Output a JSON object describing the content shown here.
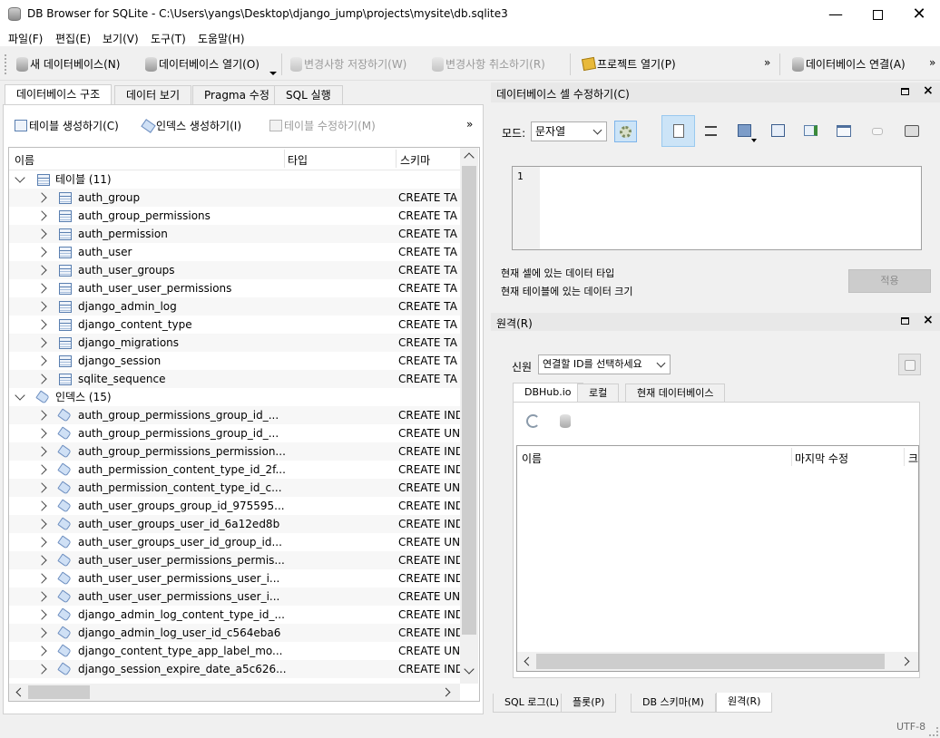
{
  "window": {
    "title": "DB Browser for SQLite - C:\\Users\\yangs\\Desktop\\django_jump\\projects\\mysite\\db.sqlite3"
  },
  "menu": [
    "파일(F)",
    "편집(E)",
    "보기(V)",
    "도구(T)",
    "도움말(H)"
  ],
  "toolbar": {
    "new_db": "새 데이터베이스(N)",
    "open_db": "데이터베이스 열기(O)",
    "write_changes": "변경사항 저장하기(W)",
    "revert_changes": "변경사항 취소하기(R)",
    "open_project": "프로젝트 열기(P)",
    "attach_db": "데이터베이스 연결(A)",
    "more": "»"
  },
  "main_tabs": [
    "데이터베이스 구조",
    "데이터 보기",
    "Pragma 수정",
    "SQL 실행"
  ],
  "structure": {
    "create_table": "테이블 생성하기(C)",
    "create_index": "인덱스 생성하기(I)",
    "modify_table": "테이블 수정하기(M)",
    "more": "»",
    "columns": [
      "이름",
      "타입",
      "스키마"
    ],
    "tables_group": "테이블 (11)",
    "tables": [
      {
        "name": "auth_group",
        "schema": "CREATE TA"
      },
      {
        "name": "auth_group_permissions",
        "schema": "CREATE TA"
      },
      {
        "name": "auth_permission",
        "schema": "CREATE TA"
      },
      {
        "name": "auth_user",
        "schema": "CREATE TA"
      },
      {
        "name": "auth_user_groups",
        "schema": "CREATE TA"
      },
      {
        "name": "auth_user_user_permissions",
        "schema": "CREATE TA"
      },
      {
        "name": "django_admin_log",
        "schema": "CREATE TA"
      },
      {
        "name": "django_content_type",
        "schema": "CREATE TA"
      },
      {
        "name": "django_migrations",
        "schema": "CREATE TA"
      },
      {
        "name": "django_session",
        "schema": "CREATE TA"
      },
      {
        "name": "sqlite_sequence",
        "schema": "CREATE TA"
      }
    ],
    "indexes_group": "인덱스 (15)",
    "indexes": [
      {
        "name": "auth_group_permissions_group_id_...",
        "schema": "CREATE IND"
      },
      {
        "name": "auth_group_permissions_group_id_...",
        "schema": "CREATE UN"
      },
      {
        "name": "auth_group_permissions_permission...",
        "schema": "CREATE IND"
      },
      {
        "name": "auth_permission_content_type_id_2f...",
        "schema": "CREATE IND"
      },
      {
        "name": "auth_permission_content_type_id_c...",
        "schema": "CREATE UN"
      },
      {
        "name": "auth_user_groups_group_id_975595...",
        "schema": "CREATE IND"
      },
      {
        "name": "auth_user_groups_user_id_6a12ed8b",
        "schema": "CREATE IND"
      },
      {
        "name": "auth_user_groups_user_id_group_id...",
        "schema": "CREATE UN"
      },
      {
        "name": "auth_user_user_permissions_permis...",
        "schema": "CREATE IND"
      },
      {
        "name": "auth_user_user_permissions_user_i...",
        "schema": "CREATE IND"
      },
      {
        "name": "auth_user_user_permissions_user_i...",
        "schema": "CREATE UN"
      },
      {
        "name": "django_admin_log_content_type_id_...",
        "schema": "CREATE IND"
      },
      {
        "name": "django_admin_log_user_id_c564eba6",
        "schema": "CREATE IND"
      },
      {
        "name": "django_content_type_app_label_mo...",
        "schema": "CREATE UN"
      },
      {
        "name": "django_session_expire_date_a5c626...",
        "schema": "CREATE IND"
      }
    ]
  },
  "edit_cell": {
    "title": "데이터베이스 셀 수정하기(C)",
    "mode_label": "모드:",
    "mode_value": "문자열",
    "line_number": "1",
    "type_info": "현재 셀에 있는 데이터 타입",
    "size_info": "현재 테이블에 있는 데이터 크기",
    "apply": "적용"
  },
  "remote": {
    "title": "원격(R)",
    "identity_label": "신원",
    "identity_value": "연결할 ID를 선택하세요",
    "tabs": [
      "DBHub.io",
      "로컬",
      "현재 데이터베이스"
    ],
    "columns": [
      "이름",
      "마지막 수정",
      "크"
    ]
  },
  "bottom_tabs": [
    "SQL 로그(L)",
    "플롯(P)",
    "DB 스키마(M)",
    "원격(R)"
  ],
  "status": {
    "encoding": "UTF-8"
  }
}
